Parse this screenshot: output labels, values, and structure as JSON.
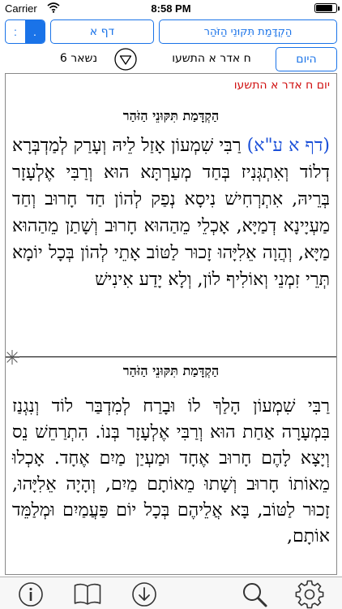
{
  "status": {
    "carrier": "Carrier",
    "time": "8:58 PM",
    "battery_level": 0.85
  },
  "toolbar": {
    "seg_left": ":",
    "seg_right": ".",
    "daf_button": "דף א",
    "section_button": "הַקְדָּמַת תִּקּוּנֵי הַזֹּהַר",
    "today_button": "היום"
  },
  "info": {
    "remaining": "נשאר 6",
    "date": "ח אדר א התשעו"
  },
  "content": {
    "top": {
      "date_red": "יום ח אדר א התשעו",
      "title": "הַקְדָּמַת תִּקּוּנֵי הַזֹּהַר",
      "daf_ref": "(דף א ע\"א)",
      "text": "רַבִּי שִׁמְעוֹן אָזַל לֵיהּ וְעָרַק לְמַדְבְּרָא דְלוֹד וְאִתְגְּנִיז בְּחַד מְעַרְתָּא הוּא וְרַבִּי אֶלְעָזָר בְּרֵיהּ, אִתְרְחִישׁ נִיסָא נְפַק לְהוֹן חַד חָרוּב וְחַד מַעְיָינָא דְמַיָּא, אָכְלֵי מֵהַהוּא חָרוּב וְשָׁתַן מֵהַהוּא מַיָּא, וְהֲוָה אֵלִיָּהוּ זָכוּר לַטּוֹב אָתֵי לְהוֹן בְּכָל יוֹמָא תְּרֵי זִמְנֵי וְאוֹלִיף לוֹן, וְלָא יָדַע אִינִישׁ"
    },
    "bottom": {
      "title": "הַקְדָּמַת תִּקּוּנֵי הַזֹּהַר",
      "text": "רַבִּי שִׁמְעוֹן הָלַךְ לוֹ וּבָרַח לְמִדְבַּר לוֹד וְנִגְנַז בִּמְעָרָה אַחַת הוּא וְרַבִּי אֶלְעָזָר בְּנוֹ. הִתְרַחֵשׁ נֵס וְיָצָא לָהֶם חָרוּב אֶחָד וּמַעְיַן מַיִם אֶחָד. אָכְלוּ מֵאוֹתוֹ חָרוּב וְשָׁתוּ מֵאוֹתָם מַיִם, וְהָיָה אֵלִיָּהוּ, זָכוּר לַטּוֹב, בָּא אֲלֵיהֶם בְּכָל יוֹם פַּעֲמַיִם וּמְלַמֵּד אוֹתָם,"
    }
  },
  "tabbar": {
    "icons": [
      "info-icon",
      "book-icon",
      "download-icon",
      "search-icon",
      "gear-icon"
    ]
  },
  "colors": {
    "accent": "#1a73e8",
    "date_red": "#d01010",
    "daf_ref_blue": "#1a4fd8"
  }
}
